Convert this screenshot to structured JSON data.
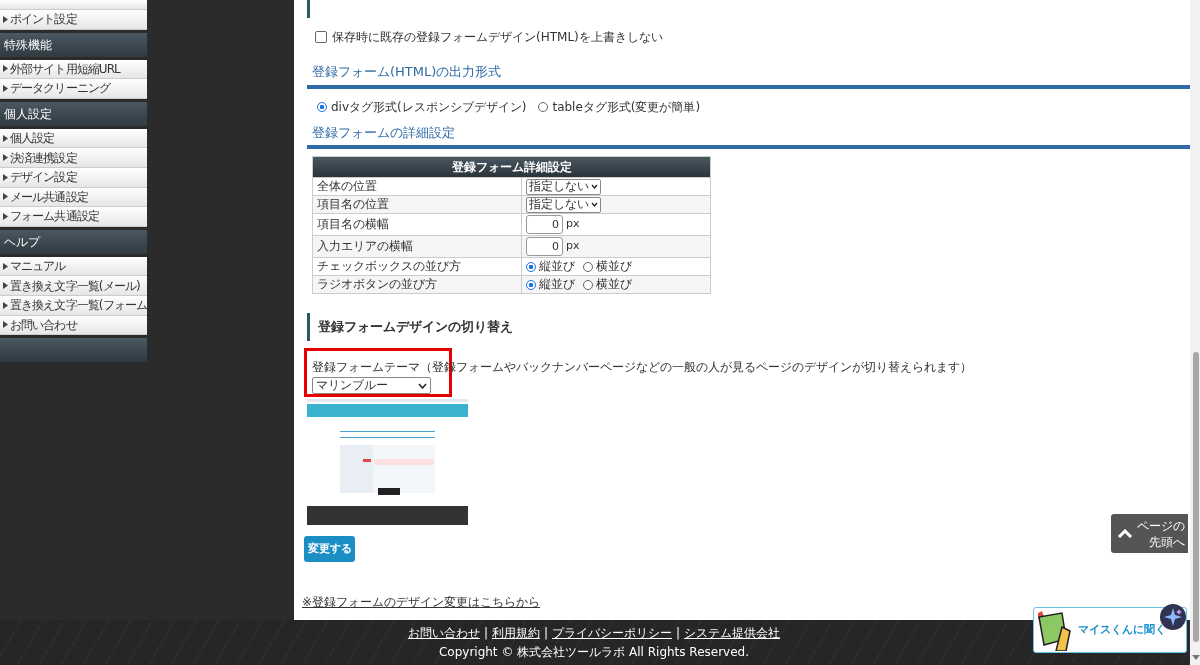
{
  "sidebar": {
    "sections": [
      {
        "items": [
          "ポイント設定"
        ]
      },
      {
        "title": "特殊機能",
        "items": [
          "外部サイト用短縮URL",
          "データクリーニング"
        ]
      },
      {
        "title": "個人設定",
        "items": [
          "個人設定",
          "決済連携設定",
          "デザイン設定",
          "メール共通設定",
          "フォーム共通設定"
        ]
      },
      {
        "title": "ヘルプ",
        "items": [
          "マニュアル",
          "置き換え文字一覧(メール)",
          "置き換え文字一覧(フォーム",
          "お問い合わせ"
        ]
      }
    ]
  },
  "output_options": {
    "overwrite_checkbox": {
      "label": "保存時に既存の登録フォームデザイン(HTML)を上書きしない",
      "checked": false
    }
  },
  "output_format": {
    "heading": "登録フォーム(HTML)の出力形式",
    "options": [
      {
        "label": "divタグ形式(レスポンシブデザイン)",
        "selected": true
      },
      {
        "label": "tableタグ形式(変更が簡単)",
        "selected": false
      }
    ]
  },
  "detail_settings": {
    "heading": "登録フォームの詳細設定",
    "table": {
      "title": "登録フォーム詳細設定",
      "rows": [
        {
          "label": "全体の位置",
          "kind": "select",
          "value": "指定しない"
        },
        {
          "label": "項目名の位置",
          "kind": "select",
          "value": "指定しない"
        },
        {
          "label": "項目名の横幅",
          "kind": "number",
          "value": "0",
          "unit": "px"
        },
        {
          "label": "入力エリアの横幅",
          "kind": "number",
          "value": "0",
          "unit": "px"
        },
        {
          "label": "チェックボックスの並び方",
          "kind": "radio",
          "options": [
            {
              "label": "縦並び",
              "selected": true
            },
            {
              "label": "横並び",
              "selected": false
            }
          ]
        },
        {
          "label": "ラジオボタンの並び方",
          "kind": "radio",
          "options": [
            {
              "label": "縦並び",
              "selected": true
            },
            {
              "label": "横並び",
              "selected": false
            }
          ]
        }
      ]
    }
  },
  "design_switch": {
    "heading": "登録フォームデザインの切り替え",
    "theme_label": "登録フォームテーマ（登録フォームやバックナンバーページなどの一般の人が見るページのデザインが切り替えられます）",
    "theme_value": "マリンブルー",
    "submit": "変更する",
    "link": "※登録フォームのデザイン変更はこちらから"
  },
  "back_to_top": {
    "line1": "ページの",
    "line2": "先頭へ"
  },
  "chat_button": "マイスくんに聞く",
  "footer": {
    "links": [
      "お問い合わせ",
      "利用規約",
      "プライバシーポリシー",
      "システム提供会社"
    ],
    "separator": "|",
    "copyright": "Copyright © 株式会社ツールラボ All Rights Reserved."
  }
}
